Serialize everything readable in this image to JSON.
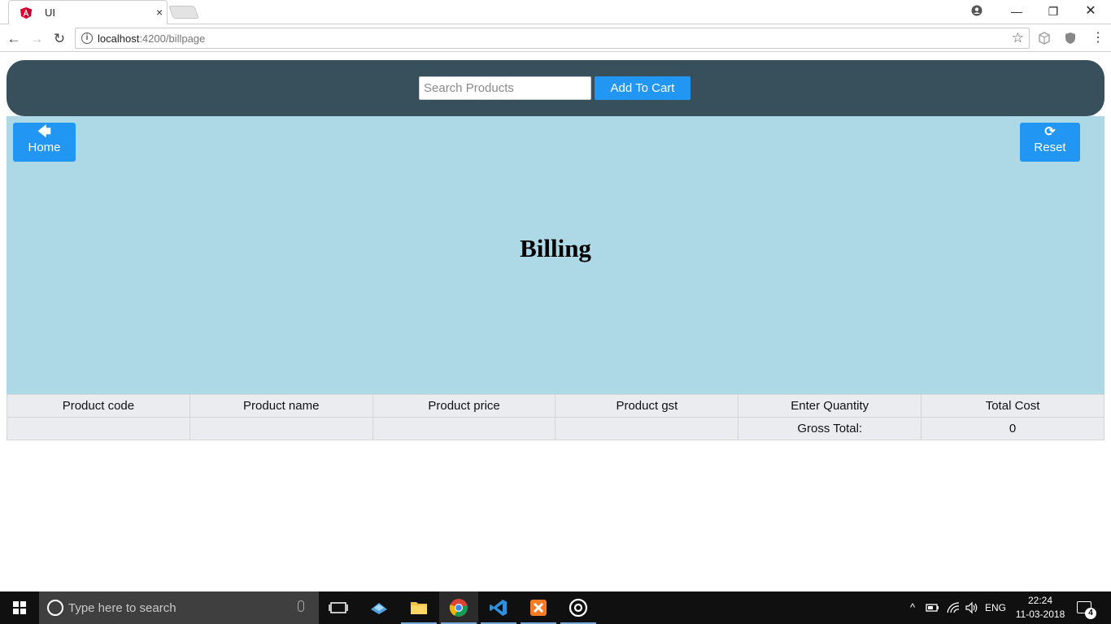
{
  "browser": {
    "tab_title": "UI",
    "tab_close": "×",
    "url_host": "localhost",
    "url_path": ":4200/billpage",
    "star": "☆",
    "menu": "⋮",
    "window_min": "—",
    "window_max": "❐",
    "window_close": "✕",
    "back": "←",
    "forward": "→",
    "reload": "↻",
    "info": "i"
  },
  "header": {
    "search_placeholder": "Search Products",
    "add_to_cart_label": "Add To Cart"
  },
  "hero": {
    "home_icon": "🡄",
    "home_label": "Home",
    "reset_icon": "⟳",
    "reset_label": "Reset",
    "title": "Billing"
  },
  "table": {
    "headers": [
      "Product code",
      "Product name",
      "Product price",
      "Product gst",
      "Enter Quantity",
      "Total Cost"
    ],
    "gross_total_label": "Gross Total:",
    "gross_total_value": "0"
  },
  "taskbar": {
    "search_placeholder": "Type here to search",
    "tray_chevron": "^",
    "language": "ENG",
    "time": "22:24",
    "date": "11-03-2018",
    "notification_count": "4"
  },
  "colors": {
    "header_bg": "#37505c",
    "hero_bg": "#add8e6",
    "button_blue": "#2196f3",
    "table_bg": "#ebecf0"
  }
}
